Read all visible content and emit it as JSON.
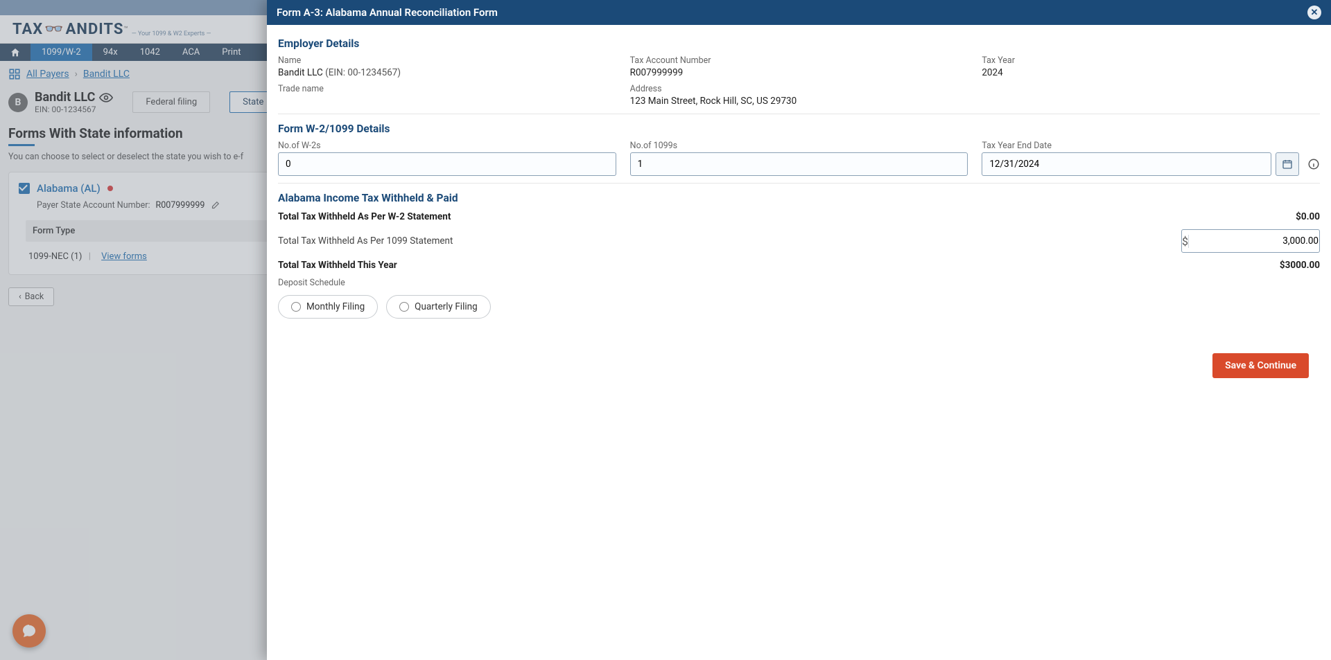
{
  "brand": {
    "name_left": "TAX",
    "name_right": "ANDITS",
    "tagline": "— Your 1099 & W2 Experts —"
  },
  "nav": {
    "items": [
      "1099/W-2",
      "94x",
      "1042",
      "ACA",
      "Print"
    ],
    "active_index": 0
  },
  "breadcrumb": {
    "all_payers": "All Payers",
    "payer": "Bandit LLC"
  },
  "payer": {
    "avatar": "B",
    "name": "Bandit LLC",
    "ein_label": "EIN: 00-1234567"
  },
  "tabs": {
    "federal": "Federal filing",
    "state": "State"
  },
  "section": {
    "title": "Forms With State information",
    "sub": "You can choose to select or deselect the state you wish to e-f"
  },
  "state_card": {
    "state": "Alabama (AL)",
    "acct_label": "Payer State Account Number:",
    "acct_value": "R007999999",
    "form_type_header": "Form Type",
    "form_line": "1099-NEC  (1)",
    "view_forms": "View forms"
  },
  "back": "Back",
  "panel": {
    "title": "Form A-3: Alabama Annual Reconciliation Form",
    "employer_h": "Employer Details",
    "name_label": "Name",
    "name_value": "Bandit LLC",
    "ein_value": "(EIN: 00-1234567)",
    "tax_acct_label": "Tax Account Number",
    "tax_acct_value": "R007999999",
    "tax_year_label": "Tax Year",
    "tax_year_value": "2024",
    "trade_label": "Trade name",
    "trade_value": "",
    "address_label": "Address",
    "address_value": "123 Main Street, Rock Hill, SC, US 29730",
    "w2_h": "Form W-2/1099 Details",
    "num_w2_label": "No.of W-2s",
    "num_w2_value": "0",
    "num_1099_label": "No.of 1099s",
    "num_1099_value": "1",
    "tye_label": "Tax Year End Date",
    "tye_value": "12/31/2024",
    "income_h": "Alabama Income Tax Withheld & Paid",
    "row_w2": "Total Tax Withheld As Per W-2 Statement",
    "row_w2_val": "$0.00",
    "row_1099": "Total Tax Withheld As Per 1099 Statement",
    "row_1099_val": "3,000.00",
    "row_total": "Total Tax Withheld This Year",
    "row_total_val": "$3000.00",
    "deposit_label": "Deposit Schedule",
    "radio_monthly": "Monthly Filing",
    "radio_quarterly": "Quarterly Filing",
    "save": "Save & Continue"
  }
}
